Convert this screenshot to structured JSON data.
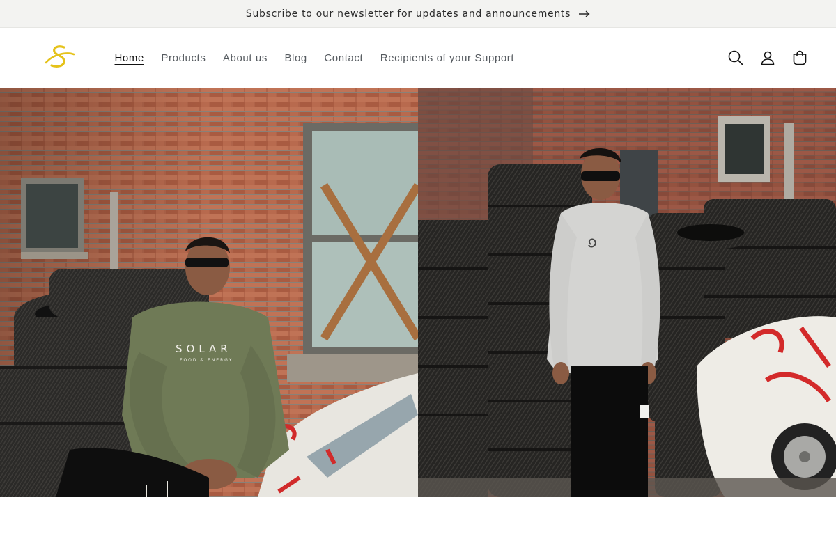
{
  "announcement": {
    "text": "Subscribe to our newsletter for updates and announcements",
    "icon": "arrow-right-icon"
  },
  "header": {
    "logo_icon": "solar-s-logo",
    "nav": [
      {
        "label": "Home",
        "active": true
      },
      {
        "label": "Products"
      },
      {
        "label": "About us"
      },
      {
        "label": "Blog"
      },
      {
        "label": "Contact"
      },
      {
        "label": "Recipients of your Support"
      }
    ],
    "icons": [
      "search-icon",
      "account-icon",
      "cart-icon"
    ]
  },
  "hero": {
    "left_image": "man-in-green-sweatshirt-seated-by-tires",
    "right_image": "man-in-grey-longsleeve-standing-by-tires",
    "left_shirt_print_top": "SOLAR",
    "left_shirt_print_bottom": "FOOD & ENERGY"
  },
  "colors": {
    "announcement_bg": "#f3f3f1",
    "logo_yellow": "#e5c21a",
    "text": "#121212",
    "nav_text": "#555a5f"
  }
}
